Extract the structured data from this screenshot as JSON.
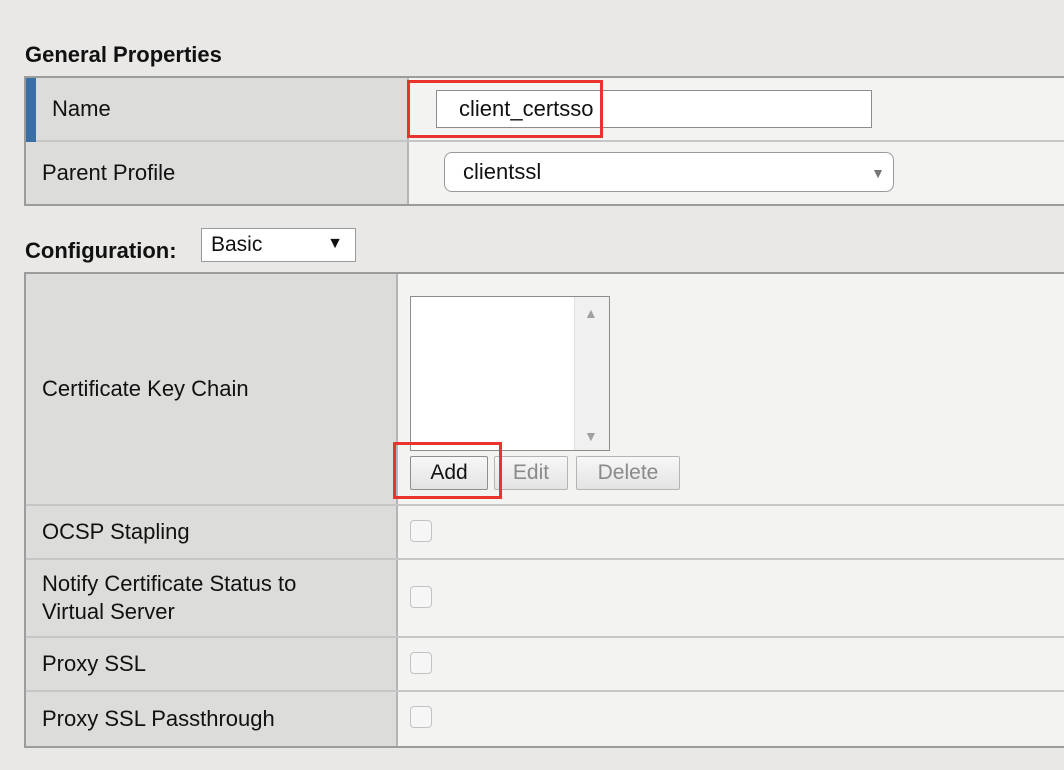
{
  "general": {
    "title": "General Properties",
    "name_label": "Name",
    "name_value": "client_certsso",
    "parent_label": "Parent Profile",
    "parent_value": "clientssl"
  },
  "configuration": {
    "label": "Configuration:",
    "mode": "Basic",
    "rows": {
      "cert_key_chain": "Certificate Key Chain",
      "ocsp_stapling": "OCSP Stapling",
      "notify_line1": "Notify Certificate Status to",
      "notify_line2": "Virtual Server",
      "proxy_ssl": "Proxy SSL",
      "proxy_ssl_passthrough": "Proxy SSL Passthrough"
    },
    "buttons": {
      "add": "Add",
      "edit": "Edit",
      "delete": "Delete"
    }
  },
  "colors": {
    "highlight": "#e8342c",
    "accent": "#3a6fa5"
  }
}
